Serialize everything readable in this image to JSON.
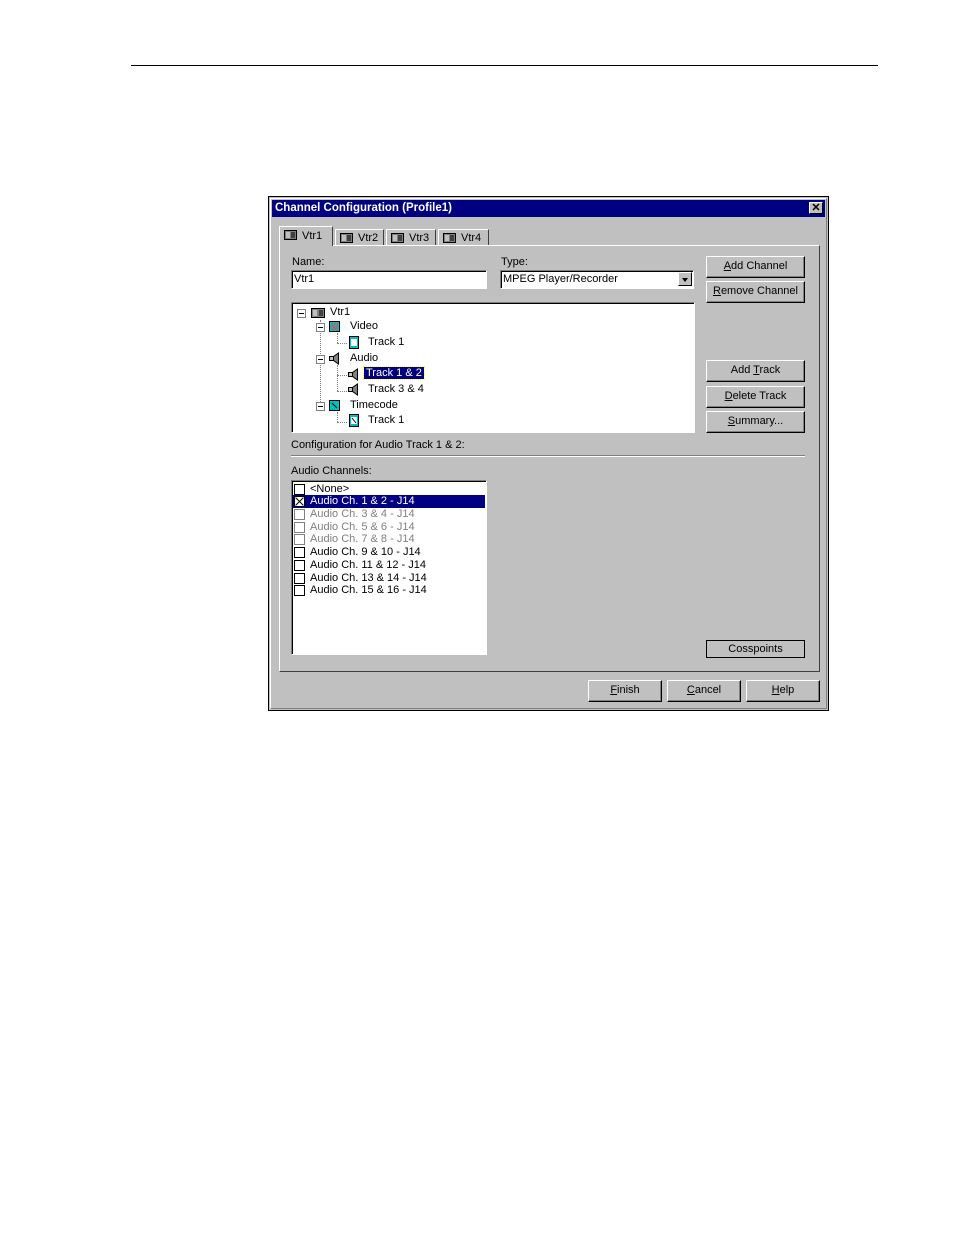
{
  "dialog": {
    "title": "Channel Configuration (Profile1)",
    "close_glyph": "✕"
  },
  "tabs": [
    {
      "label": "Vtr1",
      "icon": "vtr-icon",
      "active": true
    },
    {
      "label": "Vtr2",
      "icon": "vtr-icon",
      "active": false
    },
    {
      "label": "Vtr3",
      "icon": "vtr-icon",
      "active": false
    },
    {
      "label": "Vtr4",
      "icon": "vtr-icon",
      "active": false
    }
  ],
  "name_field": {
    "label": "Name:",
    "value": "Vtr1"
  },
  "type_field": {
    "label": "Type:",
    "value": "MPEG Player/Recorder"
  },
  "buttons": {
    "add_channel": {
      "mn": "A",
      "rest": "dd Channel"
    },
    "remove_channel": {
      "mn": "R",
      "rest": "emove Channel"
    },
    "add_track": {
      "pre": "Add ",
      "mn": "T",
      "rest": "rack"
    },
    "delete_track": {
      "mn": "D",
      "rest": "elete Track"
    },
    "summary": {
      "mn": "S",
      "rest": "ummary..."
    },
    "crosspoints": "Cosspoints",
    "finish": {
      "mn": "F",
      "rest": "inish"
    },
    "cancel": {
      "mn": "C",
      "rest": "ancel"
    },
    "help": {
      "mn": "H",
      "rest": "elp"
    }
  },
  "tree": {
    "root": "Vtr1",
    "video": "Video",
    "video_track": "Track 1",
    "audio": "Audio",
    "audio_track_1": "Track 1 & 2",
    "audio_track_2": "Track 3 & 4",
    "timecode": "Timecode",
    "timecode_track": "Track 1",
    "selected": "audio_track_1"
  },
  "config_heading": "Configuration for Audio Track 1 & 2:",
  "audio_channels": {
    "label": "Audio Channels:",
    "items": [
      {
        "label": "<None>",
        "checked": false,
        "state": "normal"
      },
      {
        "label": "Audio Ch. 1 & 2 - J14",
        "checked": true,
        "state": "selected"
      },
      {
        "label": "Audio Ch. 3 & 4 - J14",
        "checked": false,
        "state": "disabled"
      },
      {
        "label": "Audio Ch. 5 & 6 - J14",
        "checked": false,
        "state": "disabled"
      },
      {
        "label": "Audio Ch. 7 & 8 - J14",
        "checked": false,
        "state": "disabled"
      },
      {
        "label": "Audio Ch. 9 & 10 - J14",
        "checked": false,
        "state": "normal"
      },
      {
        "label": "Audio Ch. 11 & 12 - J14",
        "checked": false,
        "state": "normal"
      },
      {
        "label": "Audio Ch. 13 & 14 - J14",
        "checked": false,
        "state": "normal"
      },
      {
        "label": "Audio Ch. 15 & 16 - J14",
        "checked": false,
        "state": "normal"
      }
    ]
  },
  "colors": {
    "titlebar": "#000080",
    "face": "#c0c0c0",
    "selection": "#000080"
  }
}
